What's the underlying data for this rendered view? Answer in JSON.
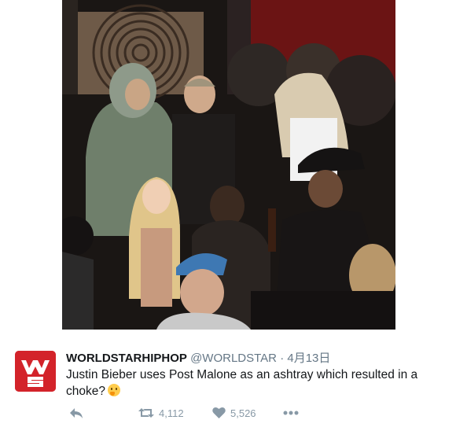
{
  "photo": {
    "description_icon": "party-photo"
  },
  "tweet": {
    "display_name": "WORLDSTARHIPHOP",
    "handle": "@WORLDSTAR",
    "separator": "·",
    "date": "4月13日",
    "text": "Justin Bieber uses Post Malone as an ashtray which resulted in a choke?",
    "emoji": "thinking-face-icon"
  },
  "actions": {
    "reply_icon": "reply-icon",
    "retweet_icon": "retweet-icon",
    "retweet_count": "4,112",
    "like_icon": "heart-icon",
    "like_count": "5,526",
    "more_icon": "more-icon"
  },
  "colors": {
    "brand_red": "#d3232a",
    "muted": "#8899a6",
    "text": "#14171a"
  }
}
